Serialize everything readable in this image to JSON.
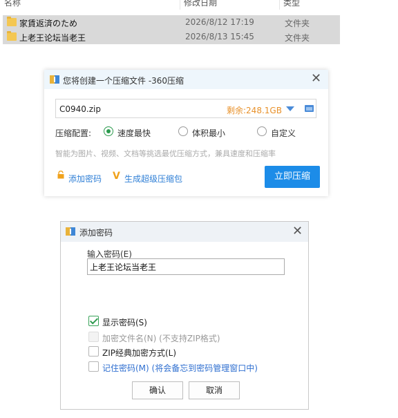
{
  "explorer": {
    "columns": [
      "名称",
      "修改日期",
      "类型"
    ],
    "rows": [
      {
        "name": "家賃返済のため",
        "date": "2026/8/12 17:19",
        "type": "文件夹"
      },
      {
        "name": "上老王论坛当老王",
        "date": "2026/8/13 15:45",
        "type": "文件夹"
      }
    ]
  },
  "compress_dialog": {
    "title": "您将创建一个压缩文件 -360压缩",
    "filename": "C0940.zip",
    "free_space": "剩余:248.1GB",
    "config_label": "压缩配置:",
    "options": [
      "速度最快",
      "体积最小",
      "自定义"
    ],
    "selected_option": "速度最快",
    "hint": "智能为图片、视频、文档等挑选最优压缩方式，兼具速度和压缩率",
    "add_password_link": "添加密码",
    "super_link": "生成超级压缩包",
    "compress_button": "立即压缩",
    "accent_color": "#1c8ce8"
  },
  "password_dialog": {
    "title": "添加密码",
    "input_label": "输入密码(E)",
    "password_value": "上老王论坛当老王",
    "checkboxes": [
      {
        "label": "显示密码(S)",
        "checked": true,
        "enabled": true
      },
      {
        "label": "加密文件名(N) (不支持ZIP格式)",
        "checked": false,
        "enabled": false
      },
      {
        "label": "ZIP经典加密方式(L)",
        "checked": false,
        "enabled": true
      },
      {
        "label": "记住密码(M) (将会备忘到密码管理窗口中)",
        "checked": false,
        "enabled": true
      }
    ],
    "ok_button": "确认",
    "cancel_button": "取消"
  }
}
